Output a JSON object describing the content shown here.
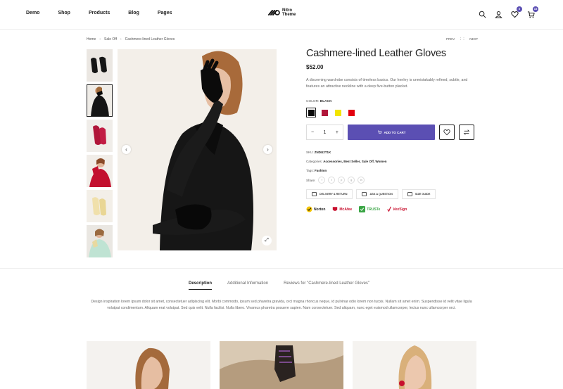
{
  "nav": {
    "items": [
      "Demo",
      "Shop",
      "Products",
      "Blog",
      "Pages"
    ]
  },
  "logo": {
    "text": "Nitro\nTheme"
  },
  "header": {
    "wishlist_count": "0",
    "cart_count": "15"
  },
  "breadcrumb": {
    "items": [
      "Home",
      "Sale Off",
      "Cashmere-lined Leather Gloves"
    ],
    "sep": "›"
  },
  "pager": {
    "prev": "PREV",
    "next": "NEXT"
  },
  "product": {
    "title": "Cashmere-lined Leather Gloves",
    "price": "$52.00",
    "description": "A discerning wardrobe consists of timeless basics. Our henley is unmistakably refined, subtle, and features an attractive neckline with a deep five-button placket.",
    "color_key": "COLOR:",
    "color_value": "BLACK",
    "swatches": [
      "#0a0a0a",
      "#b0163a",
      "#f2e500",
      "#e3000f"
    ],
    "quantity": "1",
    "add_to_cart": "ADD TO CART",
    "sku_label": "SKU:",
    "sku": "ZNDU2T1K",
    "categories_label": "Categories:",
    "categories": "Accessories, Best Seller, Sale Off, Women",
    "tags_label": "Tags:",
    "tags": "Fashion",
    "share_label": "Share:",
    "share_icons": [
      "f",
      "t",
      "p",
      "g",
      "in"
    ],
    "extra_buttons": [
      "DELIVERY & RETURN",
      "ASK A QUESTION",
      "SIZE GUIDE"
    ],
    "trust": [
      {
        "name": "Norton",
        "color": "#f4c400"
      },
      {
        "name": "McAfee",
        "color": "#c8102e"
      },
      {
        "name": "TRUSTe",
        "color": "#3aa545"
      },
      {
        "name": "VeriSign",
        "color": "#c8102e"
      }
    ]
  },
  "tabs": [
    "Description",
    "Additional Information",
    "Reviews for \"Cashmere-lined Leather Gloves\""
  ],
  "tab_description": "Design inspiration lorem ipsum dolor sit amet, consectetuer adipiscing elit. Morbi commodo, ipsum sed pharetra gravida, orci magna rhoncus neque, id pulvinar odio lorem non turpis. Nullam sit amet enim. Suspendisse id velit vitae ligula volutpat condimentum. Aliquam erat volutpat. Sed quis velit. Nulla facilisi. Nulla libero. Vivamus pharetra posuere sapien. Nam consectetuer. Sed aliquam, nunc eget euismod ullamcorper, lectus nunc ullamcorper orci.",
  "colors": {
    "accent": "#5b4fb3"
  }
}
